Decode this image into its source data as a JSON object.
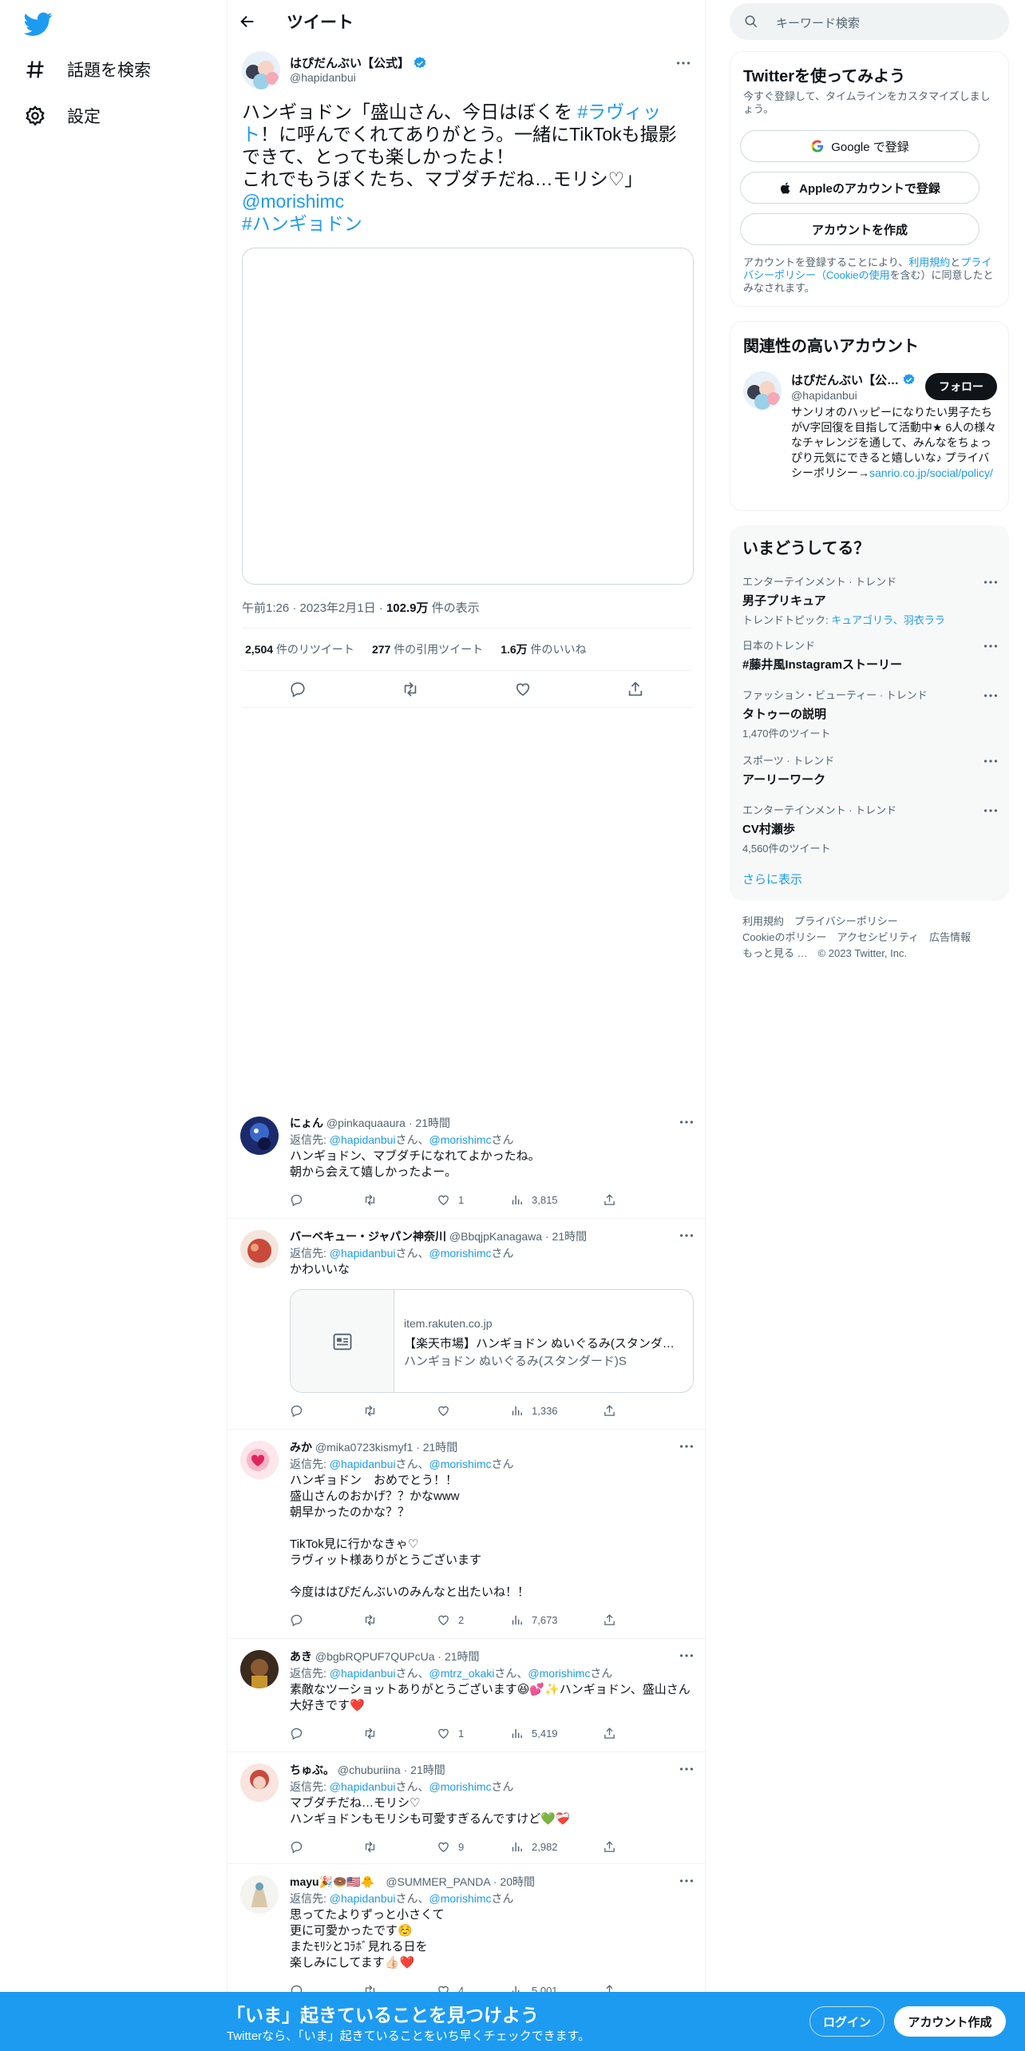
{
  "nav": {
    "explore_label": "話題を検索",
    "settings_label": "設定"
  },
  "header": {
    "title": "ツイート"
  },
  "tweet": {
    "name": "はぴだんぶい【公式】",
    "handle": "@hapidanbui",
    "text_part1": "ハンギョドン「盛山さん、今日はぼくを ",
    "hashtag1": "#ラヴィット",
    "text_part2": "！に呼んでくれてありがとう。一緒にTikTokも撮影できて、とっても楽しかったよ！\nこれでもうぼくたち、マブダチだね…モリシ♡」",
    "mention": "@morishimc",
    "hashtag2": "#ハンギョドン",
    "time": "午前1:26",
    "date": "2023年2月1日",
    "views": "102.9万",
    "views_suffix": "件の表示",
    "retweets": "2,504",
    "retweets_label": "件のリツイート",
    "quotes": "277",
    "quotes_label": "件の引用ツイート",
    "likes": "1.6万",
    "likes_label": "件のいいね"
  },
  "replies": [
    {
      "name": "にょん",
      "handle": "@pinkaquaaura",
      "time": "21時間",
      "reply_prefix": "返信先: ",
      "to1": "@hapidanbui",
      "to_sep": "さん、",
      "to2": "@morishimc",
      "to_suffix": "さん",
      "text": "ハンギョドン、マブダチになれてよかったね。\n朝から会えて嬉しかったよー。",
      "likes": "1",
      "views": "3,815"
    },
    {
      "name": "バーベキュー・ジャパン神奈川",
      "handle": "@BbqjpKanagawa",
      "time": "21時間",
      "reply_prefix": "返信先: ",
      "to1": "@hapidanbui",
      "to_sep": "さん、",
      "to2": "@morishimc",
      "to_suffix": "さん",
      "text": "かわいいな",
      "card_domain": "item.rakuten.co.jp",
      "card_title": "【楽天市場】ハンギョドン ぬいぐるみ(スタンダ…",
      "card_desc": "ハンギョドン ぬいぐるみ(スタンダード)S",
      "likes": "",
      "views": "1,336"
    },
    {
      "name": "みか",
      "handle": "@mika0723kismyf1",
      "time": "21時間",
      "reply_prefix": "返信先: ",
      "to1": "@hapidanbui",
      "to_sep": "さん、",
      "to2": "@morishimc",
      "to_suffix": "さん",
      "text": "ハンギョドン　おめでとう！！\n盛山さんのおかげ？？かなwww\n朝早かったのかな？？\n\nTikTok見に行かなきゃ♡\nラヴィット様ありがとうございます\n\n今度ははぴだんぶいのみんなと出たいね！！",
      "likes": "2",
      "views": "7,673"
    },
    {
      "name": "あき",
      "handle": "@bgbRQPUF7QUPcUa",
      "time": "21時間",
      "reply_prefix": "返信先: ",
      "to1": "@hapidanbui",
      "to_sep": "さん、",
      "to2": "@mtrz_okaki",
      "to_sep2": "さん、",
      "to3": "@morishimc",
      "to_suffix": "さん",
      "text": "素敵なツーショットありがとうございます😆💕✨ハンギョドン、盛山さん大好きです❤️",
      "likes": "1",
      "views": "5,419"
    },
    {
      "name": "ちゅぶ。",
      "handle": "@chuburiina",
      "time": "21時間",
      "reply_prefix": "返信先: ",
      "to1": "@hapidanbui",
      "to_sep": "さん、",
      "to2": "@morishimc",
      "to_suffix": "さん",
      "text": "マブダチだね…モリシ♡\nハンギョドンもモリシも可愛すぎるんですけど💚❤️‍🩹",
      "likes": "9",
      "views": "2,982"
    },
    {
      "name": "mayu🎉🍩🇺🇸🐥",
      "handle": "@SUMMER_PANDA",
      "time": "20時間",
      "reply_prefix": "返信先: ",
      "to1": "@hapidanbui",
      "to_sep": "さん、",
      "to2": "@morishimc",
      "to_suffix": "さん",
      "text": "思ってたよりずっと小さくて\n更に可愛かったです☺️\nまたﾓﾘｼとｺﾗﾎﾞ見れる日を\n楽しみにしてます👍🏻❤️",
      "likes": "4",
      "views": "5,001"
    }
  ],
  "search": {
    "placeholder": "キーワード検索"
  },
  "signup_panel": {
    "title": "Twitterを使ってみよう",
    "subtitle": "今すぐ登録して、タイムラインをカスタマイズしましょう。",
    "google_label": "Google で登録",
    "apple_label": "Appleのアカウントで登録",
    "create_label": "アカウントを作成",
    "terms_prefix": "アカウントを登録することにより、",
    "terms_link1": "利用規約",
    "terms_and": "と",
    "terms_link2": "プライバシーポリシー（Cookieの使用",
    "terms_suffix": "を含む）に同意したとみなされます。"
  },
  "related": {
    "title": "関連性の高いアカウント",
    "name": "はぴだんぶい【公…",
    "handle": "@hapidanbui",
    "follow_label": "フォロー",
    "bio": "サンリオのハッピーになりたい男子たちがV字回復を目指して活動中★ 6人の様々なチャレンジを通して、みんなをちょっぴり元気にできると嬉しいな♪ プライバシーポリシー→",
    "bio_link": "sanrio.co.jp/social/policy/"
  },
  "trends": {
    "title": "いまどうしてる？",
    "items": [
      {
        "category": "エンターテインメント · トレンド",
        "title": "男子プリキュア",
        "extra_prefix": "トレンドトピック: ",
        "extra_links": "キュアゴリラ、羽衣ララ",
        "count": ""
      },
      {
        "category": "日本のトレンド",
        "title": "#藤井風Instagramストーリー",
        "count": ""
      },
      {
        "category": "ファッション・ビューティー · トレンド",
        "title": "タトゥーの説明",
        "count": "1,470件のツイート"
      },
      {
        "category": "スポーツ · トレンド",
        "title": "アーリーワーク",
        "count": ""
      },
      {
        "category": "エンターテインメント · トレンド",
        "title": "CV村瀬歩",
        "count": "4,560件のツイート"
      }
    ],
    "show_more": "さらに表示"
  },
  "footer": {
    "line1": "利用規約　プライバシーポリシー",
    "line2": "Cookieのポリシー　アクセシビリティ　広告情報",
    "line3": "もっと見る …　© 2023 Twitter, Inc."
  },
  "bottombar": {
    "title": "「いま」起きていることを見つけよう",
    "subtitle": "Twitterなら、「いま」起きていることをいち早くチェックできます。",
    "login_label": "ログイン",
    "signup_label": "アカウント作成"
  },
  "colors": {
    "accent": "#1d9bf0",
    "text": "#0f1419",
    "secondary": "#536471",
    "like_heart": "#f91880"
  }
}
